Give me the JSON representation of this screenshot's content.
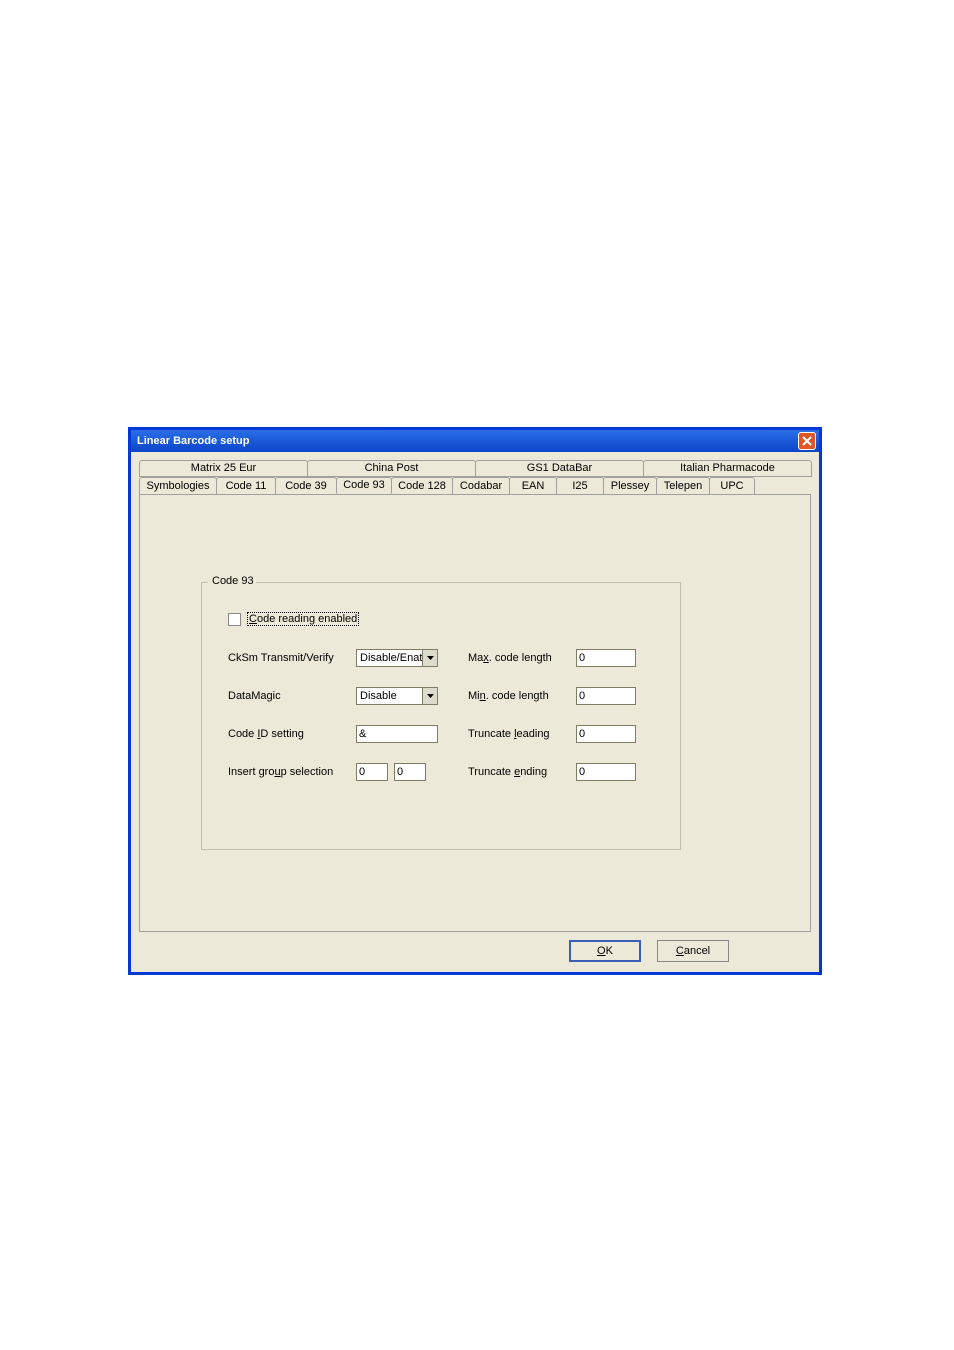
{
  "window": {
    "title": "Linear Barcode setup"
  },
  "tabs": {
    "row_top": [
      "Matrix 25 Eur",
      "China Post",
      "GS1 DataBar",
      "Italian Pharmacode"
    ],
    "row_bottom": [
      "Symbologies",
      "Code 11",
      "Code 39",
      "Code 93",
      "Code 128",
      "Codabar",
      "EAN",
      "I25",
      "Plessey",
      "Telepen",
      "UPC"
    ],
    "active": "Code 93"
  },
  "group": {
    "legend": "Code 93",
    "code_reading_label": "Code reading enabled",
    "code_reading_checked": false,
    "cksm_label": "CkSm Transmit/Verify",
    "cksm_value": "Disable/Enat",
    "datamagic_label": "DataMagic",
    "datamagic_value": "Disable",
    "codeid_label_pre": "Code ",
    "codeid_label_key": "I",
    "codeid_label_post": "D setting",
    "codeid_value": "&",
    "insertgroup_label_pre": "Insert gro",
    "insertgroup_label_key": "u",
    "insertgroup_label_post": "p selection",
    "insertgroup_v1": "0",
    "insertgroup_v2": "0",
    "maxlen_label_pre": "Ma",
    "maxlen_label_key": "x",
    "maxlen_label_post": ". code length",
    "maxlen_value": "0",
    "minlen_label_pre": "Mi",
    "minlen_label_key": "n",
    "minlen_label_post": ". code length",
    "minlen_value": "0",
    "truncl_label_pre": "Truncate ",
    "truncl_label_key": "l",
    "truncl_label_post": "eading",
    "truncl_value": "0",
    "trunce_label_pre": "Truncate ",
    "trunce_label_key": "e",
    "trunce_label_post": "nding",
    "trunce_value": "0"
  },
  "buttons": {
    "ok_key": "O",
    "ok_post": "K",
    "cancel_key": "C",
    "cancel_post": "ancel"
  }
}
